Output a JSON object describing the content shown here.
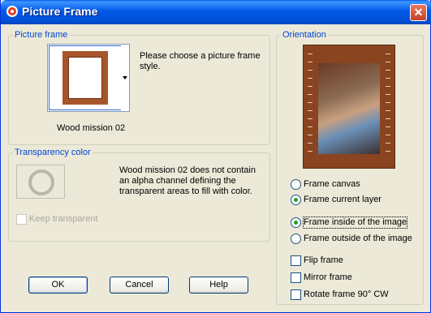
{
  "window": {
    "title": "Picture Frame"
  },
  "picture_frame": {
    "legend": "Picture frame",
    "prompt": "Please choose a picture frame style.",
    "selected_name": "Wood mission 02"
  },
  "transparency": {
    "legend": "Transparency color",
    "message": "Wood mission 02 does not contain an alpha channel defining the transparent areas to fill with color.",
    "keep_transparent_label": "Keep transparent"
  },
  "orientation": {
    "legend": "Orientation",
    "options": [
      {
        "label": "Frame canvas",
        "checked": false
      },
      {
        "label": "Frame current layer",
        "checked": true
      },
      {
        "label": "Frame inside of the image",
        "checked": true
      },
      {
        "label": "Frame outside of the image",
        "checked": false
      }
    ],
    "checkboxes": [
      {
        "label": "Flip frame",
        "checked": false
      },
      {
        "label": "Mirror frame",
        "checked": false
      },
      {
        "label": "Rotate frame 90° CW",
        "checked": false
      }
    ]
  },
  "buttons": {
    "ok": "OK",
    "cancel": "Cancel",
    "help": "Help"
  },
  "colors": {
    "title_bar": "#0058E6",
    "legend": "#0046D5",
    "frame_wood": "#A6562A",
    "dialog_bg": "#ECE9D8"
  }
}
